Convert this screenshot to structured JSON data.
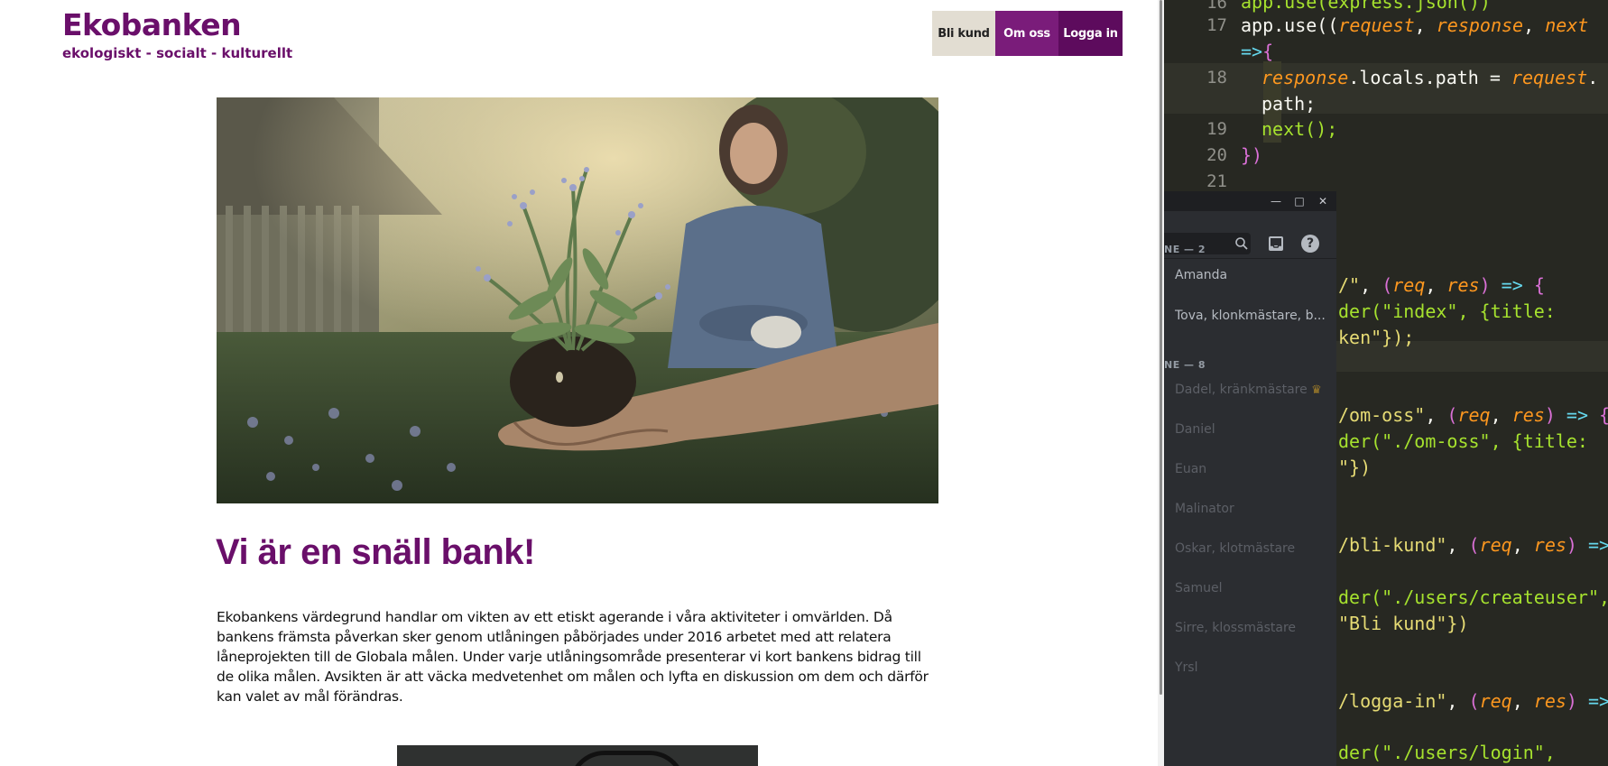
{
  "site": {
    "title": "Ekobanken",
    "tagline": "ekologiskt - socialt - kulturellt",
    "nav": {
      "bli_kund": "Bli kund",
      "om_oss": "Om oss",
      "logga_in": "Logga in"
    },
    "headline": "Vi är en snäll bank!",
    "body": "Ekobankens värdegrund handlar om vikten av ett etiskt agerande i våra aktiviteter i omvärlden. Då bankens främsta påverkan sker genom utlåningen påbörjades under 2016 arbetet med att relatera låneprojekten till de Globala målen. Under varje utlåningsområde presenterar vi kort bankens bidrag till de olika målen. Avsikten är att väcka medvetenhet om målen och lyfta en diskussion om dem och därför kan valet av mål förändras."
  },
  "editor": {
    "line_numbers": [
      "16",
      "17",
      "18",
      "19",
      "20",
      "21"
    ],
    "line16": "app.use(express.json())",
    "line17_a": "app.use((",
    "line17_request": "request",
    "line17_response": "response",
    "line17_next": "next",
    "line17_arrow": "=>",
    "line18_a": "response",
    "line18_b": ".locals.path = ",
    "line18_c": "request",
    "line18_d": "path;",
    "line19": "next();",
    "line20": "})",
    "frag_root_path": "/\"",
    "frag_req": "req",
    "frag_res": "res",
    "frag_render_index": "der(\"index\", {title:",
    "frag_ken": "ken\"});",
    "frag_om_oss": "/om-oss\"",
    "frag_render_om": "der(\"./om-oss\", {title:",
    "frag_close1": "\"})",
    "frag_bli_kund": "/bli-kund\"",
    "frag_render_create": "der(\"./users/createuser\",",
    "frag_bli_kund_title": "\"Bli kund\"})",
    "frag_logga_in": "/logga-in\"",
    "frag_render_login": "der(\"./users/login\","
  },
  "chat": {
    "section_online": "NE — 2",
    "section_offline": "NE — 8",
    "online_members": [
      "Amanda",
      "Tova, klonkmästare, b..."
    ],
    "offline_members": [
      "Dadel, kränkmästare",
      "Daniel",
      "Euan",
      "Malinator",
      "Oskar, klotmästare",
      "Samuel",
      "Sirre, klossmästare",
      "Yrsl"
    ],
    "help_glyph": "?"
  },
  "colors": {
    "brand_purple": "#6a0f6a",
    "nav_om": "#7a1c7a",
    "nav_logga": "#5d0b5d",
    "nav_bli": "#e2ddd2",
    "editor_bg": "#272822",
    "chat_bg": "#2b2d31"
  }
}
